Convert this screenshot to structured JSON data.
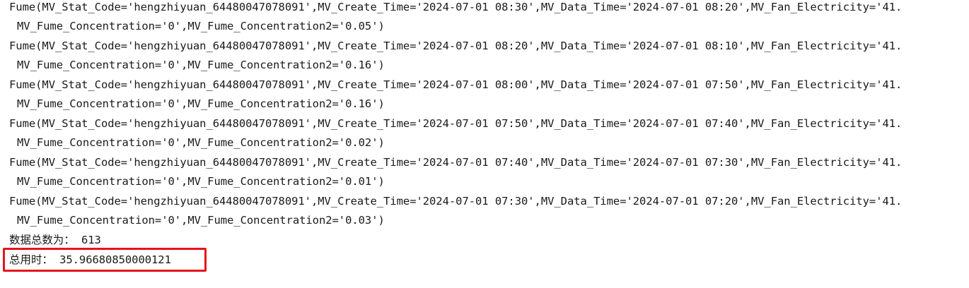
{
  "console": {
    "records": [
      {
        "line1": "Fume(MV_Stat_Code='hengzhiyuan_64480047078091',MV_Create_Time='2024-07-01 08:30',MV_Data_Time='2024-07-01 08:20',MV_Fan_Electricity='41.",
        "line2": "MV_Fume_Concentration='0',MV_Fume_Concentration2='0.05')"
      },
      {
        "line1": "Fume(MV_Stat_Code='hengzhiyuan_64480047078091',MV_Create_Time='2024-07-01 08:20',MV_Data_Time='2024-07-01 08:10',MV_Fan_Electricity='41.",
        "line2": "MV_Fume_Concentration='0',MV_Fume_Concentration2='0.16')"
      },
      {
        "line1": "Fume(MV_Stat_Code='hengzhiyuan_64480047078091',MV_Create_Time='2024-07-01 08:00',MV_Data_Time='2024-07-01 07:50',MV_Fan_Electricity='41.",
        "line2": "MV_Fume_Concentration='0',MV_Fume_Concentration2='0.16')"
      },
      {
        "line1": "Fume(MV_Stat_Code='hengzhiyuan_64480047078091',MV_Create_Time='2024-07-01 07:50',MV_Data_Time='2024-07-01 07:40',MV_Fan_Electricity='41.",
        "line2": "MV_Fume_Concentration='0',MV_Fume_Concentration2='0.02')"
      },
      {
        "line1": "Fume(MV_Stat_Code='hengzhiyuan_64480047078091',MV_Create_Time='2024-07-01 07:40',MV_Data_Time='2024-07-01 07:30',MV_Fan_Electricity='41.",
        "line2": "MV_Fume_Concentration='0',MV_Fume_Concentration2='0.01')"
      },
      {
        "line1": "Fume(MV_Stat_Code='hengzhiyuan_64480047078091',MV_Create_Time='2024-07-01 07:30',MV_Data_Time='2024-07-01 07:20',MV_Fan_Electricity='41.",
        "line2": "MV_Fume_Concentration='0',MV_Fume_Concentration2='0.03')"
      }
    ],
    "total_count": "数据总数为： 613",
    "total_time": "总用时： 35.96680850000121",
    "highlight_color": "#e5141c"
  }
}
